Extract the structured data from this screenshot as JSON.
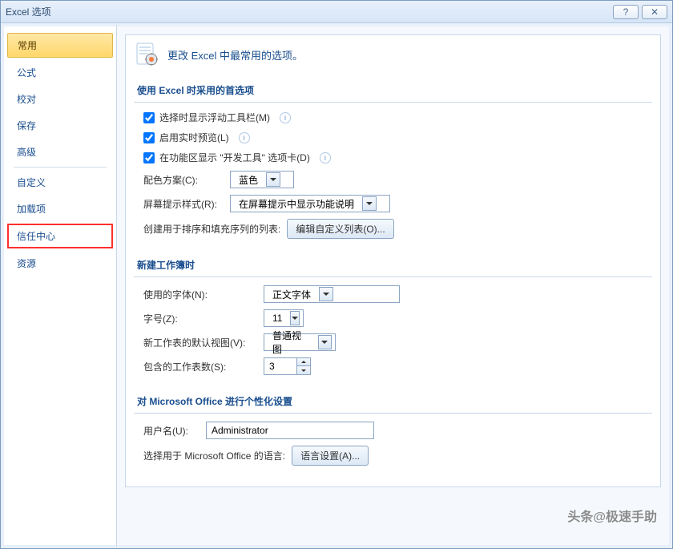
{
  "window": {
    "title": "Excel 选项",
    "help": "?",
    "close": "✕"
  },
  "sidebar": {
    "items": [
      {
        "label": "常用",
        "selected": true
      },
      {
        "label": "公式"
      },
      {
        "label": "校对"
      },
      {
        "label": "保存"
      },
      {
        "label": "高级"
      },
      {
        "sep": true
      },
      {
        "label": "自定义"
      },
      {
        "label": "加载项"
      },
      {
        "label": "信任中心",
        "highlighted": true
      },
      {
        "label": "资源"
      }
    ]
  },
  "header": {
    "text": "更改 Excel 中最常用的选项。"
  },
  "sections": {
    "s1": {
      "title": "使用 Excel 时采用的首选项",
      "chk1": "选择时显示浮动工具栏(M)",
      "chk2": "启用实时预览(L)",
      "chk3": "在功能区显示 \"开发工具\" 选项卡(D)",
      "colorLabel": "配色方案(C):",
      "colorValue": "蓝色",
      "tipLabel": "屏幕提示样式(R):",
      "tipValue": "在屏幕提示中显示功能说明",
      "listLabel": "创建用于排序和填充序列的列表:",
      "listButton": "编辑自定义列表(O)..."
    },
    "s2": {
      "title": "新建工作簿时",
      "fontLabel": "使用的字体(N):",
      "fontValue": "正文字体",
      "sizeLabel": "字号(Z):",
      "sizeValue": "11",
      "viewLabel": "新工作表的默认视图(V):",
      "viewValue": "普通视图",
      "countLabel": "包含的工作表数(S):",
      "countValue": "3"
    },
    "s3": {
      "title": "对 Microsoft Office 进行个性化设置",
      "userLabel": "用户名(U):",
      "userValue": "Administrator",
      "langLabel": "选择用于 Microsoft Office 的语言:",
      "langButton": "语言设置(A)..."
    }
  },
  "watermark": "头条@极速手助"
}
